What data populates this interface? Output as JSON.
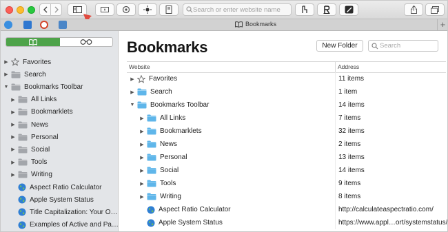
{
  "url_placeholder": "Search or enter website name",
  "tab": {
    "title": "Bookmarks",
    "plus": "+"
  },
  "sidebar": {
    "items": [
      {
        "label": "Favorites",
        "icon": "star-icon",
        "indent": 0,
        "expanded": false,
        "kind": "star"
      },
      {
        "label": "Search",
        "icon": "folder-icon",
        "indent": 0,
        "expanded": false,
        "kind": "folder"
      },
      {
        "label": "Bookmarks Toolbar",
        "icon": "folder-icon",
        "indent": 0,
        "expanded": true,
        "kind": "folder"
      },
      {
        "label": "All Links",
        "icon": "folder-icon",
        "indent": 1,
        "expanded": false,
        "kind": "folder"
      },
      {
        "label": "Bookmarklets",
        "icon": "folder-icon",
        "indent": 1,
        "expanded": false,
        "kind": "folder"
      },
      {
        "label": "News",
        "icon": "folder-icon",
        "indent": 1,
        "expanded": false,
        "kind": "folder"
      },
      {
        "label": "Personal",
        "icon": "folder-icon",
        "indent": 1,
        "expanded": false,
        "kind": "folder"
      },
      {
        "label": "Social",
        "icon": "folder-icon",
        "indent": 1,
        "expanded": false,
        "kind": "folder"
      },
      {
        "label": "Tools",
        "icon": "folder-icon",
        "indent": 1,
        "expanded": false,
        "kind": "folder"
      },
      {
        "label": "Writing",
        "icon": "folder-icon",
        "indent": 1,
        "expanded": false,
        "kind": "folder"
      },
      {
        "label": "Aspect Ratio Calculator",
        "icon": "globe-icon",
        "indent": 1,
        "expanded": null,
        "kind": "globe"
      },
      {
        "label": "Apple System Status",
        "icon": "globe-icon",
        "indent": 1,
        "expanded": null,
        "kind": "globe"
      },
      {
        "label": "Title Capitalization: Your O…",
        "icon": "globe-icon",
        "indent": 1,
        "expanded": null,
        "kind": "globe"
      },
      {
        "label": "Examples of Active and Pa…",
        "icon": "globe-icon",
        "indent": 1,
        "expanded": null,
        "kind": "globe"
      }
    ]
  },
  "main": {
    "title": "Bookmarks",
    "new_folder_label": "New Folder",
    "search_placeholder": "Search",
    "columns": {
      "website": "Website",
      "address": "Address"
    },
    "rows": [
      {
        "name": "Favorites",
        "address": "11 items",
        "indent": 0,
        "expanded": false,
        "kind": "star"
      },
      {
        "name": "Search",
        "address": "1 item",
        "indent": 0,
        "expanded": false,
        "kind": "folder"
      },
      {
        "name": "Bookmarks Toolbar",
        "address": "14 items",
        "indent": 0,
        "expanded": true,
        "kind": "folder"
      },
      {
        "name": "All Links",
        "address": "7 items",
        "indent": 1,
        "expanded": false,
        "kind": "folder"
      },
      {
        "name": "Bookmarklets",
        "address": "32 items",
        "indent": 1,
        "expanded": false,
        "kind": "folder"
      },
      {
        "name": "News",
        "address": "2 items",
        "indent": 1,
        "expanded": false,
        "kind": "folder"
      },
      {
        "name": "Personal",
        "address": "13 items",
        "indent": 1,
        "expanded": false,
        "kind": "folder"
      },
      {
        "name": "Social",
        "address": "14 items",
        "indent": 1,
        "expanded": false,
        "kind": "folder"
      },
      {
        "name": "Tools",
        "address": "9 items",
        "indent": 1,
        "expanded": false,
        "kind": "folder"
      },
      {
        "name": "Writing",
        "address": "8 items",
        "indent": 1,
        "expanded": false,
        "kind": "folder"
      },
      {
        "name": "Aspect Ratio Calculator",
        "address": "http://calculateaspectratio.com/",
        "indent": 1,
        "expanded": null,
        "kind": "globe"
      },
      {
        "name": "Apple System Status",
        "address": "https://www.appl…ort/systemstatus/",
        "indent": 1,
        "expanded": null,
        "kind": "globe"
      }
    ]
  },
  "colors": {
    "folder_sidebar": "#a3a6ab",
    "folder_main": "#5fb6ea",
    "globe": "#2f7fd3",
    "segment_active": "#4ea34a",
    "arrow_annotation": "#e04a3f"
  }
}
